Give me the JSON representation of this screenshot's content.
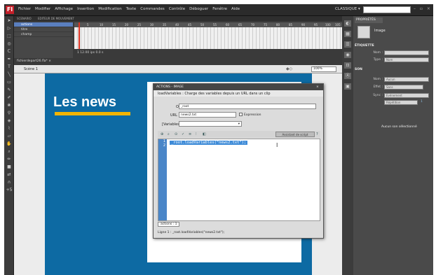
{
  "menubar": {
    "logo": "Fl",
    "items": [
      "Fichier",
      "Modifier",
      "Affichage",
      "Insertion",
      "Modification",
      "Texte",
      "Commandes",
      "Contrôle",
      "Déboguer",
      "Fenêtre",
      "Aide"
    ],
    "workspace": "CLASSIQUE ▾",
    "search_placeholder": "",
    "window_buttons": "– ▫ ×"
  },
  "timeline": {
    "tabs": [
      "SCENARIO",
      "EDITEUR DE MOUVEMENT"
    ],
    "layers": [
      {
        "name": "actions",
        "selected": true
      },
      {
        "name": "titre",
        "selected": false
      },
      {
        "name": "champ",
        "selected": false
      }
    ],
    "ruler": [
      "5",
      "10",
      "15",
      "20",
      "25",
      "30",
      "35",
      "40",
      "45",
      "50",
      "55",
      "60",
      "65",
      "70",
      "75",
      "80",
      "85",
      "90",
      "95",
      "100",
      "105"
    ],
    "status": "1   12.00 ips   0.0 s"
  },
  "document": {
    "tab": "fichierdepart26.fla* ×",
    "scene": "Scène 1",
    "zoom": "100%"
  },
  "stage": {
    "title": "Les news",
    "bg_color": "#0d6aa3",
    "bar_color": "#f2b400"
  },
  "actions_panel": {
    "title": "ACTIONS - IMAGE",
    "description": "loadVariables : Charge des variables depuis un URL dans un clip",
    "objet_label": "Objet :",
    "objet_value": "_root",
    "url_label": "URL :",
    "url_value": "news2.txt",
    "expression_label": "Expression",
    "variables_label": "[Variables] :",
    "assistant_label": "Assistant de script",
    "line_numbers": [
      "1",
      "2"
    ],
    "code": "_root.loadVariables(\"news2.txt\");",
    "bottom_tab": "actions : 1",
    "status_line": "Ligne 1 : _root.loadVariables(\"news2.txt\");"
  },
  "properties": {
    "tab": "PROPRIÉTÉS",
    "type_label": "Image",
    "section_label": "ÉTIQUETTE",
    "nom_label": "Nom :",
    "type_field_label": "Type :",
    "type_value": "Nom",
    "son_section": "SON",
    "son_nom_label": "Nom :",
    "son_nom_value": "Aucun",
    "effet_label": "Effet :",
    "effet_value": "Sans",
    "sync_label": "Sync :",
    "sync_value": "Evénement",
    "repeat_value": "Répétition",
    "repeat_count": "1",
    "none_selected": "Aucun son sélectionné"
  }
}
